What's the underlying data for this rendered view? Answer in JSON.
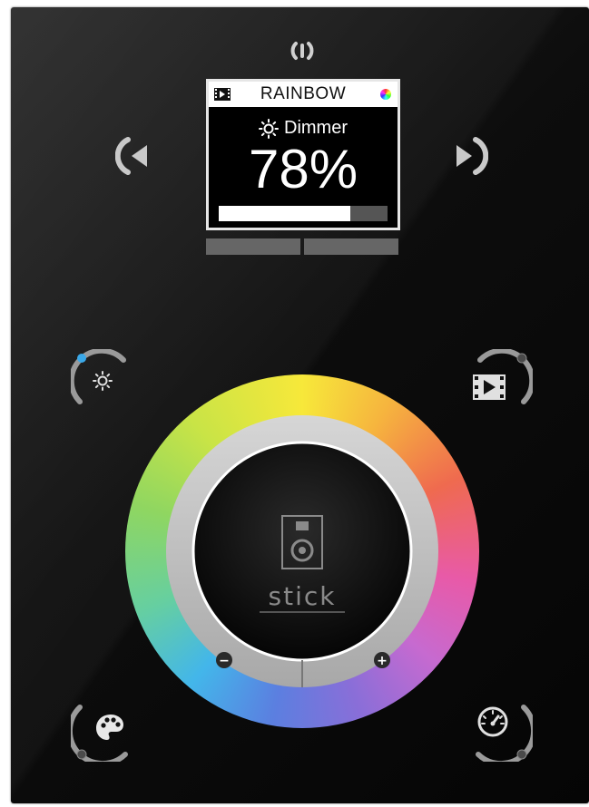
{
  "screen": {
    "title": "RAINBOW",
    "parameter": "Dimmer",
    "value": "78%",
    "level_fraction": 0.78
  },
  "icons": {
    "power": "power-icon",
    "prev": "arrow-left-icon",
    "next": "arrow-right-icon",
    "dimmer": "sun-icon",
    "scene": "film-play-icon",
    "palette": "palette-icon",
    "speed": "speedometer-icon"
  },
  "wheel": {
    "brand": "stick",
    "minus_label": "−",
    "plus_label": "+"
  },
  "colors": {
    "indicator_active": "#3aa8e8",
    "ring_gray": "#b8b8b8"
  }
}
